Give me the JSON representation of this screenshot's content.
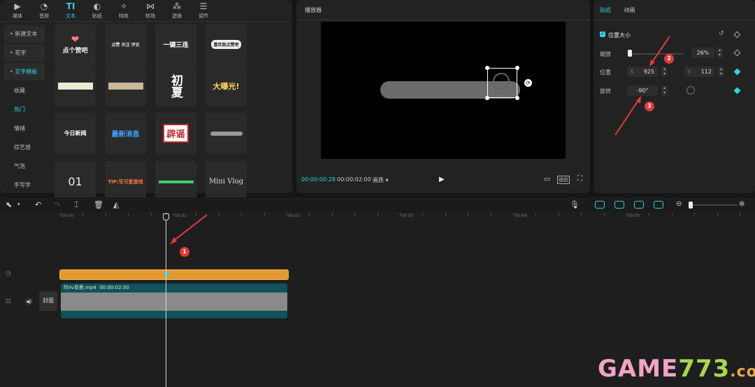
{
  "top_nav": [
    {
      "label": "媒体",
      "icon": "media-icon"
    },
    {
      "label": "音频",
      "icon": "audio-icon"
    },
    {
      "label": "文本",
      "icon": "text-icon",
      "active": true
    },
    {
      "label": "贴纸",
      "icon": "sticker-icon"
    },
    {
      "label": "特效",
      "icon": "effects-icon"
    },
    {
      "label": "转场",
      "icon": "transition-icon"
    },
    {
      "label": "滤镜",
      "icon": "filter-icon"
    },
    {
      "label": "调节",
      "icon": "adjust-icon"
    }
  ],
  "sidebar": {
    "new_text": "新建文本",
    "fancy": "花字",
    "template": "文字模板",
    "sub": [
      "收藏",
      "热门",
      "情绪",
      "综艺感",
      "气泡",
      "手写字"
    ]
  },
  "tiles": [
    "点个赞吧",
    "点赞 关注 评论",
    "一键三连",
    "喜欢就点赞吧",
    "",
    "",
    "初夏",
    "大曝光!",
    "今日新闻",
    "最新消息",
    "辟谣",
    "",
    "01",
    "TIP:写可爱游戏",
    "",
    "Mini Vlog"
  ],
  "player": {
    "title": "播放器",
    "current_time": "00:00:00:28",
    "total_time": "00:00:02:00",
    "quality": "画质",
    "fit": "适应"
  },
  "right_panel": {
    "tabs": [
      "贴纸",
      "动画"
    ],
    "section": "位置大小",
    "scale_label": "缩放",
    "scale_value": "26%",
    "position_label": "位置",
    "x_label": "X",
    "x_value": "925",
    "y_label": "Y",
    "y_value": "112",
    "rotation_label": "旋转",
    "rotation_value": "-90°"
  },
  "timeline": {
    "ruler": [
      "00:00",
      "00:01",
      "00:02",
      "00:03",
      "00:04",
      "00:05"
    ],
    "clip_name": "fll/iv背景.mp4",
    "clip_duration": "00:00:02:00",
    "cover_label": "封面"
  },
  "annotations": [
    "1",
    "2",
    "3"
  ],
  "watermark": {
    "text1": "GAME",
    "text2": "773",
    ".com": ".com"
  },
  "colors": {
    "accent": "#2fd3e0",
    "orange": "#e39a2e",
    "teal": "#0f5257",
    "red": "#e03a3a"
  }
}
